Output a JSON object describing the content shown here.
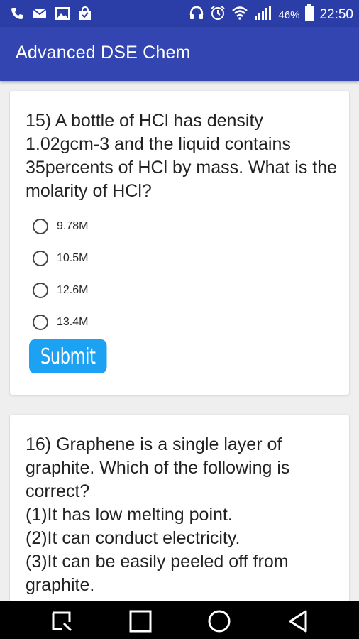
{
  "status_bar": {
    "battery": "46%",
    "time": "22:50"
  },
  "app": {
    "title": "Advanced DSE Chem"
  },
  "question_15": {
    "text": "15) A bottle of HCl has density 1.02gcm-3 and the liquid contains 35percents of HCl by mass. What is the molarity of HCl?",
    "options": [
      "9.78M",
      "10.5M",
      "12.6M",
      "13.4M"
    ],
    "submit_label": "Submit"
  },
  "question_16": {
    "text_lines": [
      "16) Graphene is a single layer of graphite. Which of the following is correct?",
      "(1)It has low melting point.",
      "(2)It can conduct electricity.",
      "(3)It can be easily peeled off from graphite."
    ]
  },
  "colors": {
    "status_bar": "#2b3ea8",
    "app_bar": "#3345b0",
    "submit_button": "#1da1f2"
  },
  "icons": [
    "phone-icon",
    "mail-icon",
    "image-icon",
    "shopping-bag-icon",
    "headset-icon",
    "alarm-icon",
    "wifi-icon",
    "signal-icon",
    "battery-icon",
    "recents-icon",
    "home-icon",
    "back-icon"
  ]
}
